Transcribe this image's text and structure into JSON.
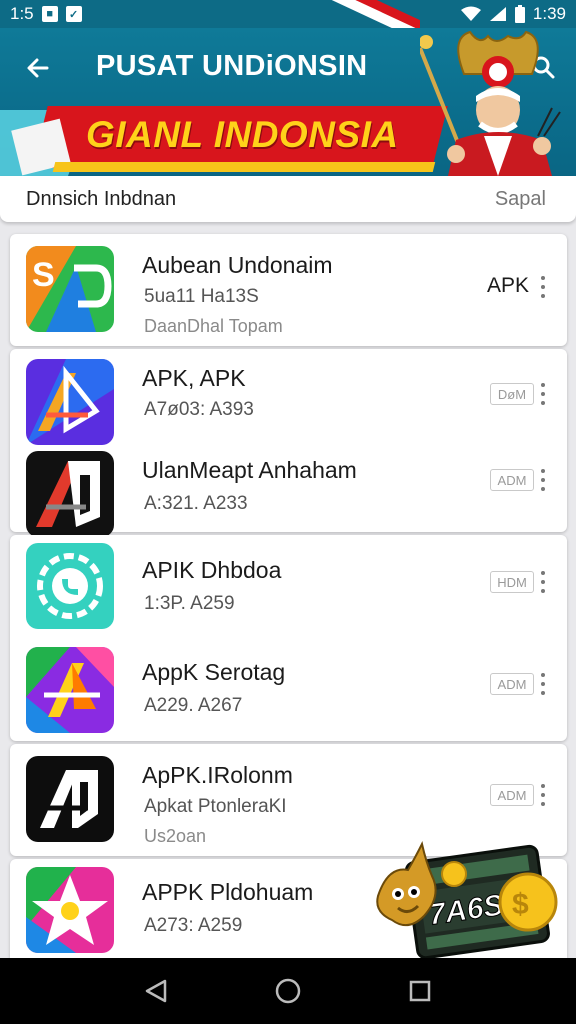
{
  "status_bar": {
    "time_left": "1:5",
    "time_right": "1:39"
  },
  "header": {
    "title": "PUSAT UNDiONSIN",
    "banner_text": "GIANL INDONSIA",
    "back_icon": "arrow-left-icon",
    "search_icon": "search-icon"
  },
  "sub_bar": {
    "text": "Dnnsich Inbdnan",
    "action": "Sapal"
  },
  "apps": [
    {
      "name": "Aubean Undonaim",
      "line1": "5ua11 Ha13S",
      "line2": "DaanDhal Topam",
      "badge": "APK",
      "icon": "green-orange-s-logo-icon"
    },
    {
      "name": "APK, APK",
      "line1": "A7ø03: A393",
      "line2": "",
      "badge": "DøM",
      "icon": "blue-purple-a-logo-icon"
    },
    {
      "name": "UlanMeapt Anhaham",
      "line1": "A:321. A233",
      "line2": "",
      "badge": "ADM",
      "icon": "black-red-a-logo-icon"
    },
    {
      "name": "APIK Dhbdoa",
      "line1": "1:3P. A259",
      "line2": "",
      "badge": "HDM",
      "icon": "teal-gear-logo-icon"
    },
    {
      "name": "AppK Serotag",
      "line1": "A229. A267",
      "line2": "",
      "badge": "ADM",
      "icon": "rainbow-a-logo-icon"
    },
    {
      "name": "ApPK.IRolonm",
      "line1": "Apkat PtonleraKI",
      "line2": "Us2oan",
      "badge": "ADM",
      "icon": "black-white-a-logo-icon"
    },
    {
      "name": "APPK Pldohuam",
      "line1": "A273: A259",
      "line2": "",
      "badge": "",
      "icon": "star-logo-icon"
    }
  ],
  "promo": {
    "text": "7A6S"
  },
  "nav": {
    "back": "nav-back-icon",
    "home": "nav-home-icon",
    "recents": "nav-recents-icon"
  },
  "colors": {
    "header": "#0b6d8c",
    "banner_red": "#d8151c",
    "banner_yellow": "#ffd21a"
  }
}
